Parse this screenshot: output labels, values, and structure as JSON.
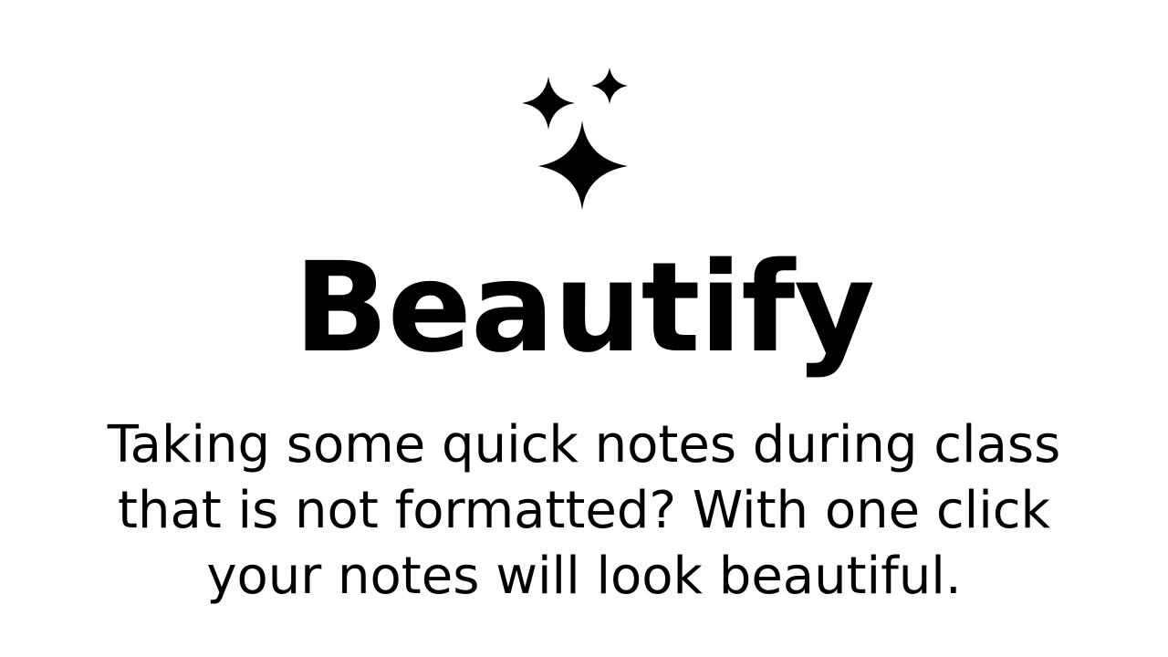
{
  "icon": {
    "name": "sparkles-icon",
    "color": "#000000"
  },
  "title": "Beautify",
  "description": {
    "lines": [
      "Taking some quick notes during class",
      "that is not formatted? With one click",
      "your notes will look beautiful."
    ]
  },
  "colors": {
    "background": "#ffffff",
    "text": "#000000"
  }
}
